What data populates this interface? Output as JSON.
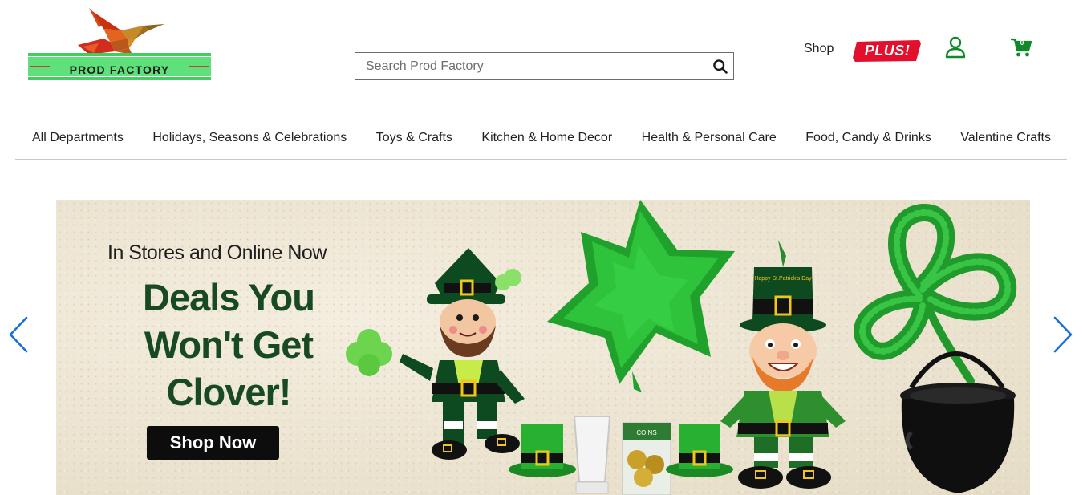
{
  "header": {
    "logo_text": "PROD FACTORY",
    "search_placeholder": "Search Prod Factory",
    "shop_label": "Shop",
    "plus_label": "PLUS!",
    "cart_count": "0",
    "colors": {
      "brand_green": "#0f8a2a",
      "plus_red": "#e2102d",
      "logo_bar": "#4cd964"
    }
  },
  "nav": {
    "items": [
      "All Departments",
      "Holidays, Seasons & Celebrations",
      "Toys & Crafts",
      "Kitchen & Home Decor",
      "Health & Personal Care",
      "Food, Candy & Drinks",
      "Valentine Crafts"
    ]
  },
  "hero": {
    "subheading": "In Stores and Online Now",
    "headline": "Deals You Won't Get Clover!",
    "cta_label": "Shop Now",
    "hat_text": "Happy St.Patrick's Day",
    "coin_pack_text": "COINS",
    "colors": {
      "headline": "#174a22",
      "cta_bg": "#0d0d0d",
      "arrow": "#1a6fd4"
    }
  },
  "icons": {
    "search": "search-icon",
    "account": "account-icon",
    "cart": "cart-icon",
    "prev": "chevron-left-icon",
    "next": "chevron-right-icon"
  }
}
